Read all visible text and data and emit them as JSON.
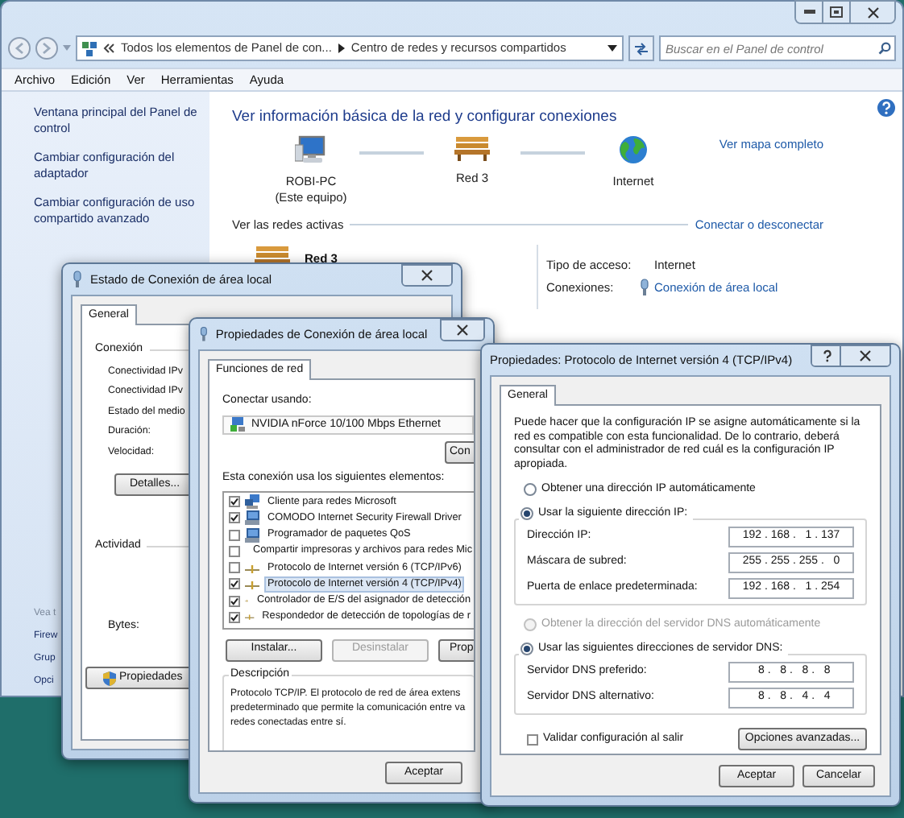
{
  "explorer": {
    "address": {
      "crumbs": [
        "Todos los elementos de Panel de con...",
        "Centro de redes y recursos compartidos"
      ]
    },
    "search": {
      "placeholder": "Buscar en el Panel de control"
    },
    "menu": [
      "Archivo",
      "Edición",
      "Ver",
      "Herramientas",
      "Ayuda"
    ],
    "sidebar": {
      "links": [
        "Ventana principal del Panel de control",
        "Cambiar configuración del adaptador",
        "Cambiar configuración de uso compartido avanzado"
      ],
      "see_also_heading": "Vea t",
      "see_also": [
        "Firew",
        "Grup",
        "Opci"
      ]
    },
    "title": "Ver información básica de la red y configurar conexiones",
    "map": {
      "nodes": [
        {
          "kind": "computer",
          "label": "ROBI-PC",
          "sublabel": "(Este equipo)"
        },
        {
          "kind": "network",
          "label": "Red 3"
        },
        {
          "kind": "internet",
          "label": "Internet"
        }
      ],
      "full_map_link": "Ver mapa completo"
    },
    "active_networks": {
      "heading": "Ver las redes activas",
      "link": "Conectar o desconectar",
      "network_name": "Red 3",
      "access_label": "Tipo de acceso:",
      "access_value": "Internet",
      "connections_label": "Conexiones:",
      "connection_link": "Conexión de área local"
    }
  },
  "status_dialog": {
    "title": "Estado de Conexión de área local",
    "tabs": [
      {
        "label": "General",
        "selected": true
      }
    ],
    "connection_heading": "Conexión",
    "rows": [
      "Conectividad IPv",
      "Conectividad IPv",
      "Estado del medio",
      "Duración:",
      "Velocidad:"
    ],
    "details_button": "Detalles...",
    "activity_heading": "Actividad",
    "bytes_label": "Bytes:",
    "properties_button": "Propiedades"
  },
  "properties_dialog": {
    "title": "Propiedades de Conexión de área local",
    "tabs": [
      {
        "label": "Funciones de red",
        "selected": true
      }
    ],
    "connect_using_label": "Conectar usando:",
    "adapter": "NVIDIA nForce 10/100 Mbps Ethernet",
    "configure_button": "Con",
    "items_label": "Esta conexión usa los siguientes elementos:",
    "items": [
      {
        "kind": "client",
        "label": "Cliente para redes Microsoft",
        "checked": true,
        "selected": false
      },
      {
        "kind": "service",
        "label": "COMODO Internet Security Firewall Driver",
        "checked": true,
        "selected": false
      },
      {
        "kind": "service",
        "label": "Programador de paquetes QoS",
        "checked": false,
        "selected": false
      },
      {
        "kind": "service",
        "label": "Compartir impresoras y archivos para redes Mic",
        "checked": false,
        "selected": false
      },
      {
        "kind": "protocol",
        "label": "Protocolo de Internet versión 6 (TCP/IPv6)",
        "checked": false,
        "selected": false
      },
      {
        "kind": "protocol",
        "label": "Protocolo de Internet versión 4 (TCP/IPv4)",
        "checked": true,
        "selected": true
      },
      {
        "kind": "protocol",
        "label": "Controlador de E/S del asignador de detección",
        "checked": true,
        "selected": false
      },
      {
        "kind": "protocol",
        "label": "Respondedor de detección de topologías de r",
        "checked": true,
        "selected": false
      }
    ],
    "buttons": [
      {
        "label": "Instalar...",
        "disabled": false
      },
      {
        "label": "Desinstalar",
        "disabled": true
      },
      {
        "label": "Prop",
        "disabled": false
      }
    ],
    "description_heading": "Descripción",
    "description_lines": [
      "Protocolo TCP/IP. El protocolo de red de área extens",
      "predeterminado que permite la comunicación entre va",
      "redes conectadas entre sí."
    ],
    "ok_button": "Aceptar"
  },
  "ipv4_dialog": {
    "title": "Propiedades: Protocolo de Internet versión 4 (TCP/IPv4)",
    "tabs": [
      {
        "label": "General",
        "selected": true
      }
    ],
    "intro": "Puede hacer que la configuración IP se asigne automáticamente si la red es compatible con esta funcionalidad. De lo contrario, deberá consultar con el administrador de red cuál es la configuración IP apropiada.",
    "ip_options": [
      {
        "label": "Obtener una dirección IP automáticamente",
        "selected": false,
        "disabled": false
      },
      {
        "label": "Usar la siguiente dirección IP:",
        "selected": true,
        "disabled": false
      }
    ],
    "ip_fields": [
      {
        "label": "Dirección IP:",
        "value": "192 . 168 .   1 . 137"
      },
      {
        "label": "Máscara de subred:",
        "value": "255 . 255 . 255 .   0"
      },
      {
        "label": "Puerta de enlace predeterminada:",
        "value": "192 . 168 .   1 . 254"
      }
    ],
    "dns_options": [
      {
        "label": "Obtener la dirección del servidor DNS automáticamente",
        "selected": false,
        "disabled": true
      },
      {
        "label": "Usar las siguientes direcciones de servidor DNS:",
        "selected": true,
        "disabled": false
      }
    ],
    "dns_fields": [
      {
        "label": "Servidor DNS preferido:",
        "value": "  8 .   8 .   8 .   8"
      },
      {
        "label": "Servidor DNS alternativo:",
        "value": "  8 .   8 .   4 .   4"
      }
    ],
    "validate": {
      "label": "Validar configuración al salir",
      "checked": false
    },
    "advanced_button": "Opciones avanzadas...",
    "ok_button": "Aceptar",
    "cancel_button": "Cancelar"
  }
}
